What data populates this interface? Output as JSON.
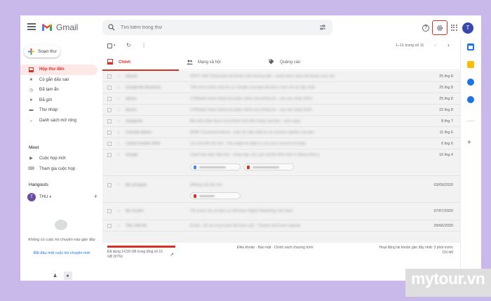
{
  "app": {
    "name": "Gmail"
  },
  "search": {
    "placeholder": "Tìm kiếm trong thư"
  },
  "account": {
    "initial": "T"
  },
  "help": {
    "glyph": "?"
  },
  "compose": {
    "label": "Soạn thư"
  },
  "nav": [
    {
      "label": "Hộp thư đến",
      "icon": "inbox-icon",
      "glyph": "▭",
      "active": true
    },
    {
      "label": "Có gắn dấu sao",
      "icon": "star-icon",
      "glyph": "★"
    },
    {
      "label": "Đã tạm ẩn",
      "icon": "clock-icon",
      "glyph": "◷"
    },
    {
      "label": "Đã gửi",
      "icon": "send-icon",
      "glyph": "➤"
    },
    {
      "label": "Thư nháp",
      "icon": "draft-icon",
      "glyph": "▬"
    },
    {
      "label": "Danh sách mở rộng",
      "icon": "expand-icon",
      "glyph": "⌄"
    }
  ],
  "meet": {
    "title": "Meet",
    "items": [
      {
        "label": "Cuộc họp mới",
        "icon": "video-camera-icon",
        "glyph": "▶"
      },
      {
        "label": "Tham gia cuộc họp",
        "icon": "keyboard-icon",
        "glyph": "⌨"
      }
    ]
  },
  "hangouts": {
    "title": "Hangouts",
    "user_name": "THU",
    "user_initial": "T",
    "caret": "▾",
    "plus": "+",
    "no_chats": "Không có cuộc trò chuyện nào gần đây",
    "start_chat": "Bắt đầu một cuộc trò chuyện mới",
    "bottom_glyphs": [
      "♟",
      "●"
    ]
  },
  "toolbar": {
    "caret": "▾",
    "refresh_glyph": "↻",
    "more_glyph": "⋮",
    "pager": "1–11 trong số 11",
    "prev": "‹",
    "next": "›"
  },
  "tabs": [
    {
      "label": "Chính",
      "icon": "inbox-icon",
      "glyph": "▣",
      "active": true
    },
    {
      "label": "Mạng xã hội",
      "icon": "people-icon",
      "glyph": "👥"
    },
    {
      "label": "Quảng cáo",
      "icon": "tag-icon",
      "glyph": "◆"
    }
  ],
  "emails": [
    {
      "sender": "tafusrit",
      "subject": "WVFT Mãi Thông báo tài khoản Hội Hướng dẫn - chính thức chọn tài khoản xem xét",
      "date": "25 thg 8"
    },
    {
      "sender": "Google My Business",
      "subject": "Tiến trình chỉnh sửa hồ sơ Google của bạn đã được xem xét và cập nhật",
      "date": "25 thg 8"
    },
    {
      "sender": "ebonic",
      "subject": "ZYRbabk Hoàn thành bộ phận chỉnh sửa thông tin - cần xác nhận thêm",
      "date": "25 thg 8"
    },
    {
      "sender": "ebonic",
      "subject": "ZYRbabk Hoàn thành bộ phận chỉnh sửa thông tin - cần xác nhận thêm",
      "date": "22 thg 8"
    },
    {
      "sender": "Instagram",
      "subject": "Bài viết nhận được lượt thích mới trên trang của bạn - xem ngay",
      "date": "8 thg 7"
    },
    {
      "sender": "Linkedin Admin",
      "subject": "WWF Connected Alerts - Liên hệ cập nhật hồ sơ chuyên nghiệp của bạn",
      "date": "11 thg 6"
    },
    {
      "sender": "Linked Invitatn 2024",
      "subject": "Lời mời kết nối mới - You might be able to use your account to login",
      "date": "6 thg 6"
    },
    {
      "sender": "Google",
      "subject": "Cảnh báo bảo mật mới - Chào bạn, Em gửi cái file đính kèm ở đúng mình ạ",
      "date": "16 thg 4",
      "chips": [
        "#4285f4",
        "#d93025"
      ]
    },
    {
      "sender": "Bin phvgadv",
      "subject": "Những vấn đề mới",
      "date": "03/09/2020",
      "chips": [
        "#d93025"
      ]
    },
    {
      "sender": "Bin Kyokin",
      "subject": "Tôi muốn hỏi về dịch vụ Hội thảo Digital Marketing Viet Nam",
      "date": "07/07/2020"
    },
    {
      "sender": "Tiến Việt Hà",
      "subject": "Email - Hồ sơ ứng tuyển đã được gửi - Thanks and best regards",
      "date": "29/06/2020"
    }
  ],
  "footer": {
    "storage": "Đã dùng 14,59 GB trong tổng số 15 GB (97%)",
    "storage_percent": 97,
    "storage_link_glyph": "↗",
    "links": "Điều khoản · Bảo mật · Chính sách chương trình",
    "activity": "Hoạt động tài khoản gần đây nhất: 3 phút trước",
    "details": "Chi tiết"
  },
  "right_rail": [
    {
      "icon": "calendar-icon",
      "color": "#1a73e8"
    },
    {
      "icon": "keep-icon",
      "color": "#fbbc04"
    },
    {
      "icon": "tasks-icon",
      "color": "#1a73e8"
    },
    {
      "icon": "contacts-icon",
      "color": "#1a73e8"
    }
  ],
  "right_rail_plus": "+",
  "watermark": "mytour.vn",
  "colors": {
    "accent_red": "#d93025",
    "selection_bg": "#fce8e6",
    "avatar": "#3949ab",
    "page_bg": "#c9b8ea"
  }
}
